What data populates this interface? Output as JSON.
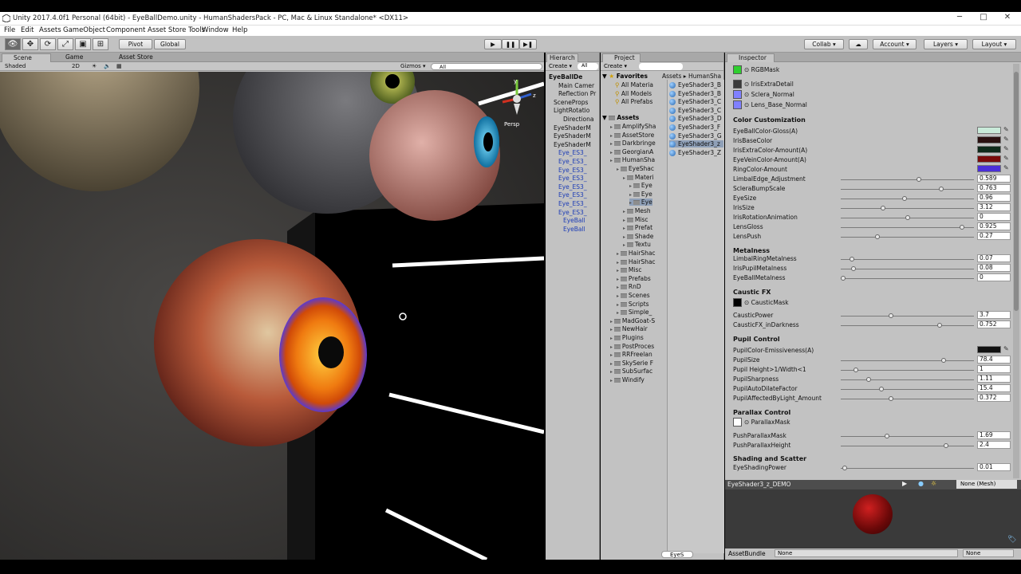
{
  "window": {
    "title": "Unity 2017.4.0f1 Personal (64bit) - EyeBallDemo.unity - HumanShadersPack - PC, Mac & Linux Standalone* <DX11>"
  },
  "menu": [
    "File",
    "Edit",
    "Assets",
    "GameObject",
    "Component",
    "Asset Store Tools",
    "Window",
    "Help"
  ],
  "toolbar": {
    "pivot": "Pivot",
    "global": "Global",
    "collab": "Collab ▾",
    "account": "Account",
    "layers": "Layers",
    "layout": "Layout"
  },
  "scene": {
    "tabs": [
      "Scene",
      "Game",
      "Asset Store"
    ],
    "shading": "Shaded",
    "mode2d": "2D",
    "gizmos": "Gizmos ▾",
    "search": "All",
    "persp": "Persp"
  },
  "hierarchy": {
    "tab": "Hierarch",
    "create": "Create ▾",
    "search": "All",
    "items": [
      {
        "label": "EyeBallDe",
        "bold": true,
        "blue": false,
        "indent": 0
      },
      {
        "label": "Main Camer",
        "bold": false,
        "blue": false,
        "indent": 2
      },
      {
        "label": "Reflection Pr",
        "bold": false,
        "blue": false,
        "indent": 2
      },
      {
        "label": "SceneProps",
        "bold": false,
        "blue": false,
        "indent": 1
      },
      {
        "label": "LightRotatio",
        "bold": false,
        "blue": false,
        "indent": 1
      },
      {
        "label": "Directiona",
        "bold": false,
        "blue": false,
        "indent": 3
      },
      {
        "label": "EyeShaderM",
        "bold": false,
        "blue": false,
        "indent": 1
      },
      {
        "label": "EyeShaderM",
        "bold": false,
        "blue": false,
        "indent": 1
      },
      {
        "label": "EyeShaderM",
        "bold": false,
        "blue": false,
        "indent": 1
      },
      {
        "label": "Eye_ES3_",
        "bold": false,
        "blue": true,
        "indent": 2
      },
      {
        "label": "Eye_ES3_",
        "bold": false,
        "blue": true,
        "indent": 2
      },
      {
        "label": "Eye_ES3_",
        "bold": false,
        "blue": true,
        "indent": 2
      },
      {
        "label": "Eye_ES3_",
        "bold": false,
        "blue": true,
        "indent": 2
      },
      {
        "label": "Eye_ES3_",
        "bold": false,
        "blue": true,
        "indent": 2
      },
      {
        "label": "Eye_ES3_",
        "bold": false,
        "blue": true,
        "indent": 2
      },
      {
        "label": "Eye_ES3_",
        "bold": false,
        "blue": true,
        "indent": 2
      },
      {
        "label": "Eye_ES3_",
        "bold": false,
        "blue": true,
        "indent": 2
      },
      {
        "label": "EyeBall",
        "bold": false,
        "blue": true,
        "indent": 3
      },
      {
        "label": "EyeBall",
        "bold": false,
        "blue": true,
        "indent": 3
      }
    ]
  },
  "project": {
    "tab": "Project",
    "create": "Create ▾",
    "breadcrumb": "Assets ▸ HumanSha",
    "favorites_label": "Favorites",
    "favorites": [
      "All Materia",
      "All Models",
      "All Prefabs"
    ],
    "assets_label": "Assets",
    "tree": [
      {
        "label": "AmplifySha",
        "indent": 1
      },
      {
        "label": "AssetStore",
        "indent": 1
      },
      {
        "label": "Darkbringe",
        "indent": 1
      },
      {
        "label": "GeorgianA",
        "indent": 1
      },
      {
        "label": "HumanSha",
        "indent": 1
      },
      {
        "label": "EyeShac",
        "indent": 2
      },
      {
        "label": "Materi",
        "indent": 3
      },
      {
        "label": "Eye",
        "indent": 4
      },
      {
        "label": "Eye",
        "indent": 4
      },
      {
        "label": "Eye",
        "indent": 4
      },
      {
        "label": "Mesh",
        "indent": 3
      },
      {
        "label": "Misc",
        "indent": 3
      },
      {
        "label": "Prefat",
        "indent": 3
      },
      {
        "label": "Shade",
        "indent": 3
      },
      {
        "label": "Textu",
        "indent": 3
      },
      {
        "label": "HairShac",
        "indent": 2
      },
      {
        "label": "HairShac",
        "indent": 2
      },
      {
        "label": "Misc",
        "indent": 2
      },
      {
        "label": "Prefabs",
        "indent": 2
      },
      {
        "label": "RnD",
        "indent": 2
      },
      {
        "label": "Scenes",
        "indent": 2
      },
      {
        "label": "Scripts",
        "indent": 2
      },
      {
        "label": "Simple_",
        "indent": 2
      },
      {
        "label": "MadGoat-S",
        "indent": 1
      },
      {
        "label": "NewHair",
        "indent": 1
      },
      {
        "label": "Plugins",
        "indent": 1
      },
      {
        "label": "PostProces",
        "indent": 1
      },
      {
        "label": "RRFreelan",
        "indent": 1
      },
      {
        "label": "SkySerie F",
        "indent": 1
      },
      {
        "label": "SubSurfac",
        "indent": 1
      },
      {
        "label": "Windify",
        "indent": 1
      }
    ],
    "assets": [
      "EyeShader3_B",
      "EyeShader3_B",
      "EyeShader3_C",
      "EyeShader3_C",
      "EyeShader3_D",
      "EyeShader3_F",
      "EyeShader3_G",
      "EyeShader3_z",
      "EyeShader3_Z"
    ],
    "selected_asset": 7,
    "bottom_label": "EyeS"
  },
  "inspector": {
    "tab": "Inspector",
    "textures_top": [
      {
        "label": "RGBMask",
        "color": "#2fcf2f"
      },
      {
        "label": "IrisExtraDetail",
        "color": "#3a3a3a"
      },
      {
        "label": "Sclera_Normal",
        "color": "#8080ff"
      },
      {
        "label": "Lens_Base_Normal",
        "color": "#8080ff"
      }
    ],
    "color_header": "Color Customization",
    "colors": [
      {
        "label": "EyeBallColor-Gloss(A)",
        "color": "#c9ead9"
      },
      {
        "label": "IrisBaseColor",
        "color": "#2a1010"
      },
      {
        "label": "IrisExtraColor-Amount(A)",
        "color": "#0e2a1a"
      },
      {
        "label": "EyeVeinColor-Amount(A)",
        "color": "#7a0a0a"
      },
      {
        "label": "RingColor-Amount",
        "color": "#4b2fd8"
      }
    ],
    "sliders1": [
      {
        "label": "LimbalEdge_Adjustment",
        "value": "0.589",
        "pos": 0.589
      },
      {
        "label": "ScleraBumpScale",
        "value": "0.763",
        "pos": 0.763
      },
      {
        "label": "EyeSize",
        "value": "0.96",
        "pos": 0.48
      },
      {
        "label": "IrisSize",
        "value": "3.12",
        "pos": 0.31
      },
      {
        "label": "IrisRotationAnimation",
        "value": "0",
        "pos": 0.5
      },
      {
        "label": "LensGloss",
        "value": "0.925",
        "pos": 0.925
      },
      {
        "label": "LensPush",
        "value": "0.27",
        "pos": 0.27
      }
    ],
    "metal_header": "Metalness",
    "sliders2": [
      {
        "label": "LimbalRingMetalness",
        "value": "0.07",
        "pos": 0.07
      },
      {
        "label": "IrisPupilMetalness",
        "value": "0.08",
        "pos": 0.08
      },
      {
        "label": "EyeBallMetalness",
        "value": "0",
        "pos": 0.0
      }
    ],
    "caustic_header": "Caustic FX",
    "caustic_mask": "CausticMask",
    "sliders3": [
      {
        "label": "CausticPower",
        "value": "3.7",
        "pos": 0.37
      },
      {
        "label": "CausticFX_inDarkness",
        "value": "0.752",
        "pos": 0.752
      }
    ],
    "pupil_header": "Pupil Control",
    "pupil_color": {
      "label": "PupilColor-Emissiveness(A)",
      "color": "#111111"
    },
    "sliders4": [
      {
        "label": "PupilSize",
        "value": "78.4",
        "pos": 0.784
      },
      {
        "label": "Pupil Height>1/Width<1",
        "value": "1",
        "pos": 0.1
      },
      {
        "label": "PupilSharpness",
        "value": "1.11",
        "pos": 0.2
      },
      {
        "label": "PupilAutoDilateFactor",
        "value": "15.4",
        "pos": 0.3
      },
      {
        "label": "PupilAffectedByLight_Amount",
        "value": "0.372",
        "pos": 0.372
      }
    ],
    "parallax_header": "Parallax Control",
    "parallax_mask": "ParallaxMask",
    "sliders5": [
      {
        "label": "PushParallaxMask",
        "value": "1.69",
        "pos": 0.34
      },
      {
        "label": "PushParallaxHeight",
        "value": "2.4",
        "pos": 0.8
      }
    ],
    "shading_header": "Shading and Scatter",
    "sliders6": [
      {
        "label": "EyeShadingPower",
        "value": "0.01",
        "pos": 0.01
      }
    ]
  },
  "preview": {
    "title": "EyeShader3_z_DEMO",
    "mesh": "None (Mesh)",
    "assetbundle": "AssetBundle",
    "bundle_value": "None",
    "variant_value": "None"
  }
}
